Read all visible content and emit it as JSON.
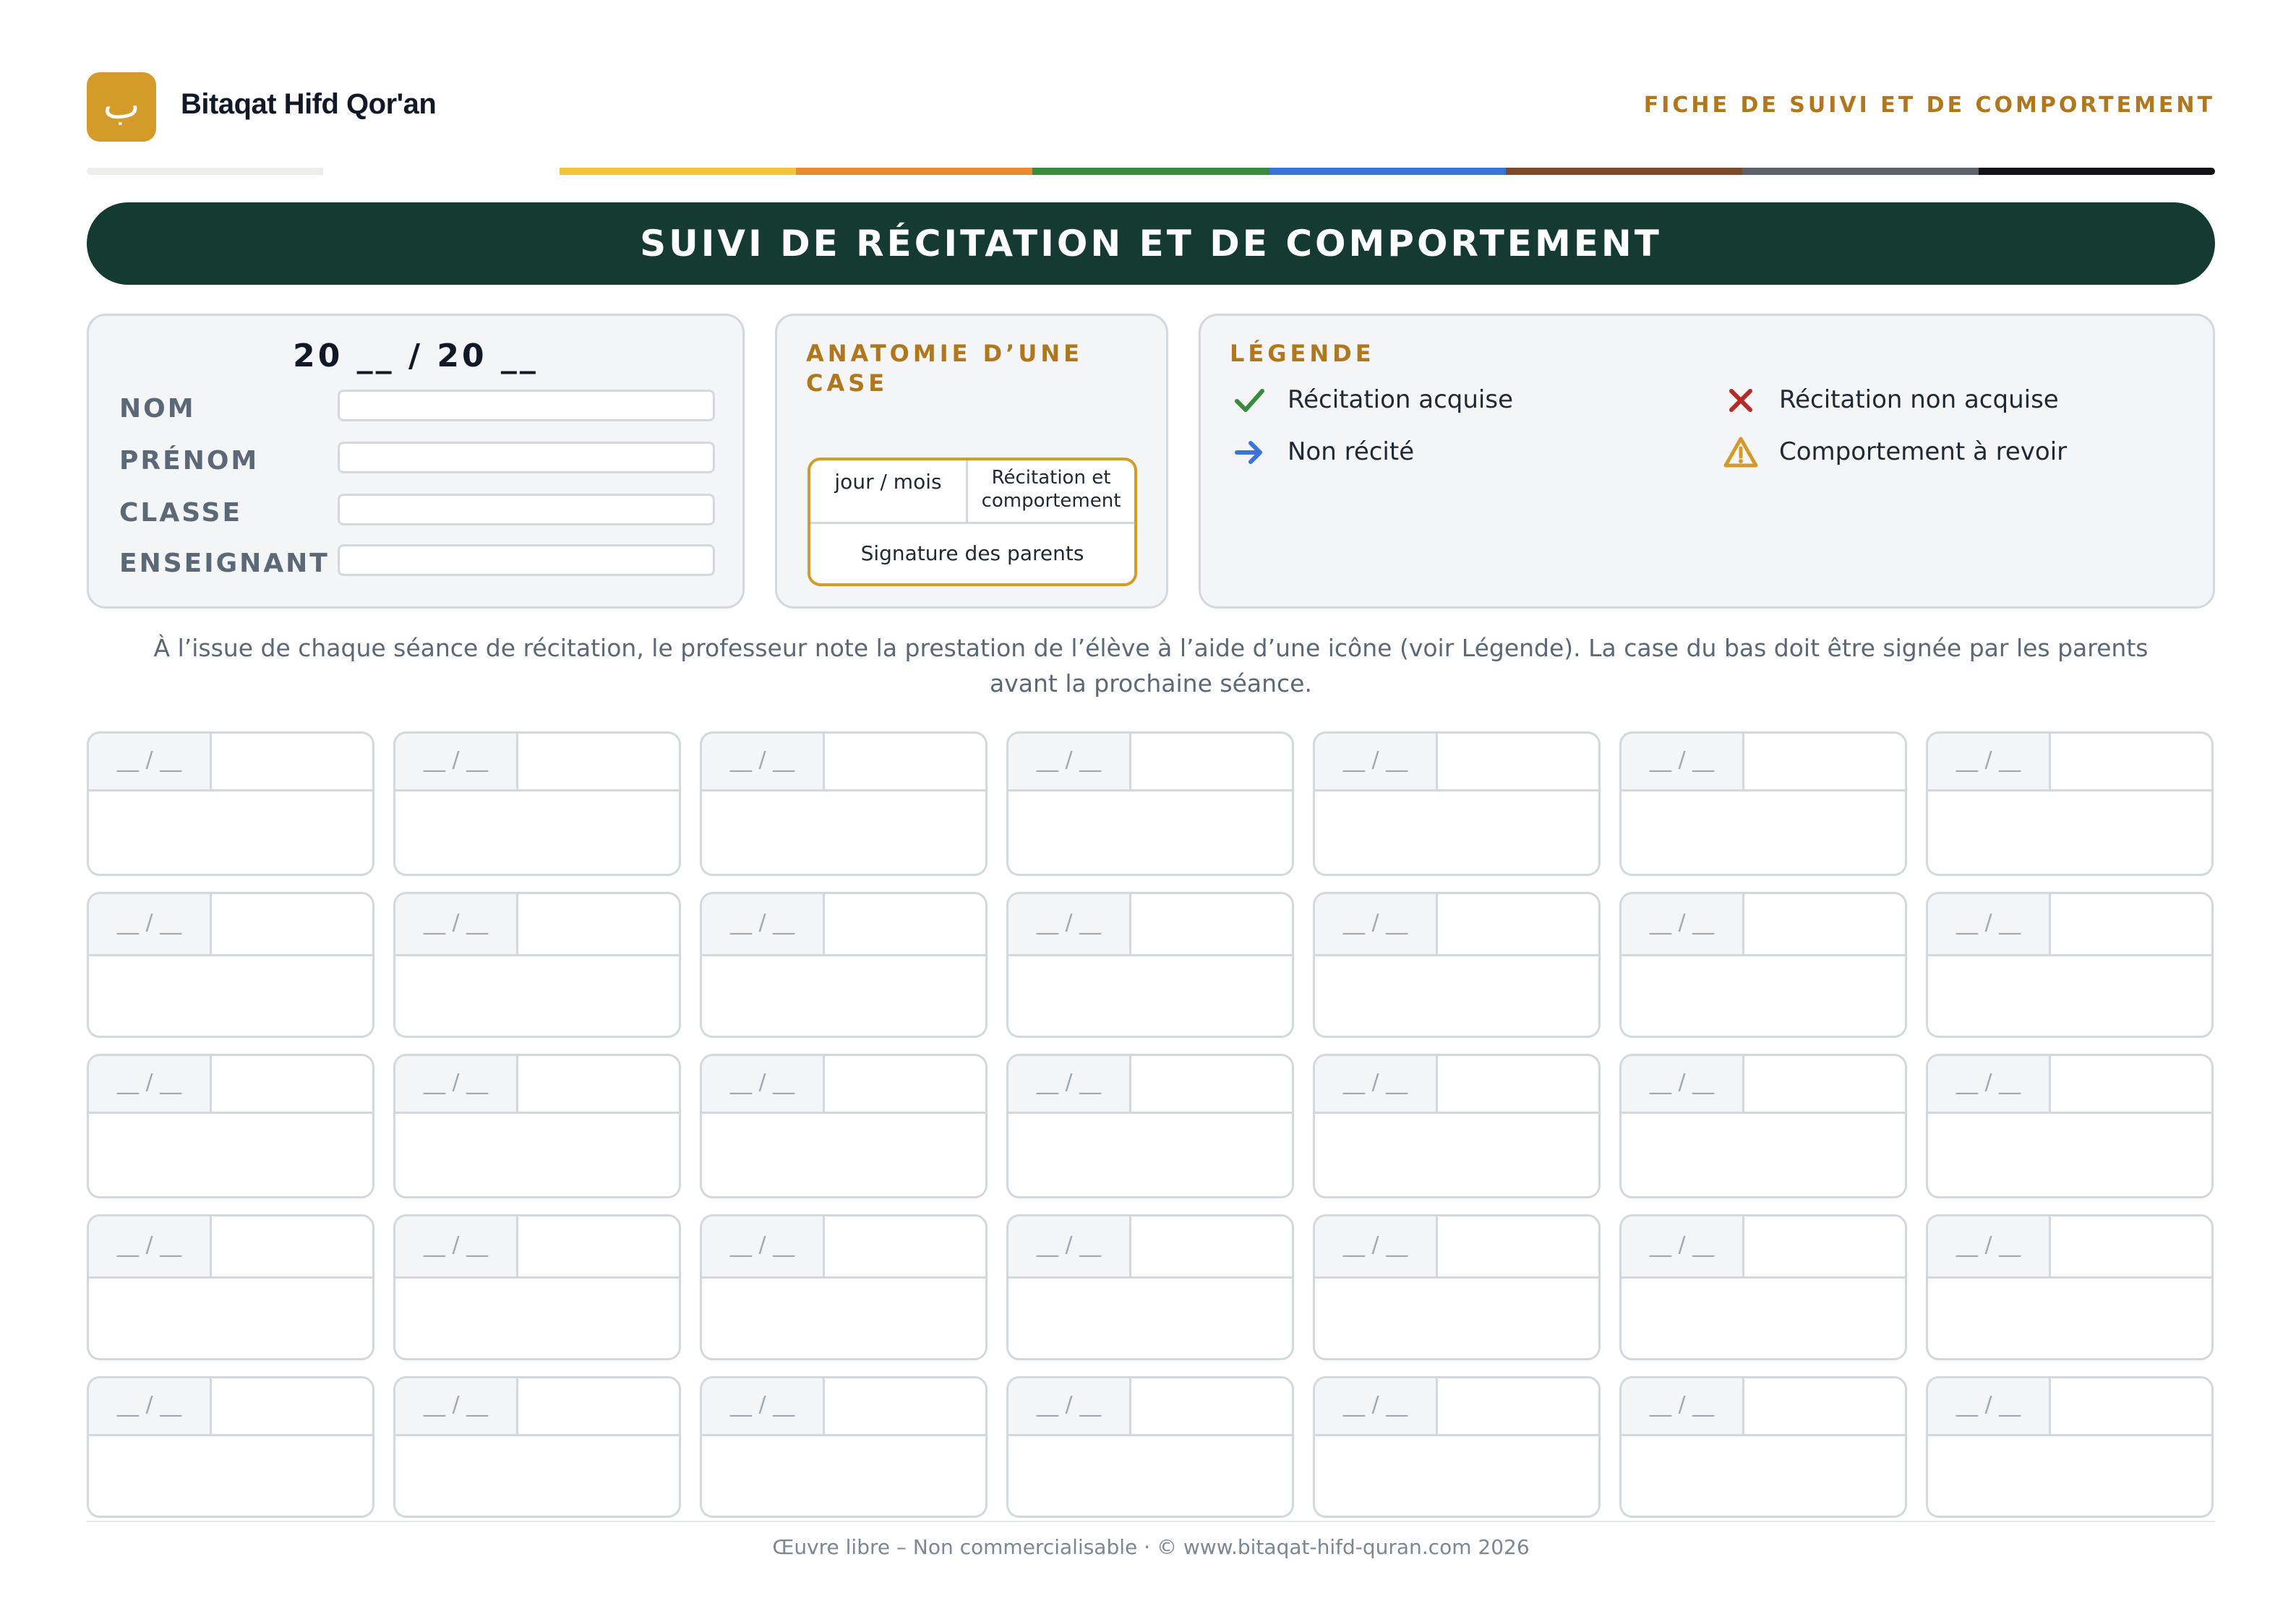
{
  "header": {
    "logo_glyph": "ب",
    "brand": "Bitaqat Hifd Qor'an",
    "doc_type": "FICHE DE SUIVI ET DE COMPORTEMENT"
  },
  "strip_colors": [
    "#efedea",
    "#ffffff",
    "#f2c43a",
    "#e98a2e",
    "#3a8a3e",
    "#3b74d8",
    "#7a4a2a",
    "#5b6069",
    "#111318"
  ],
  "title": "SUIVI DE RÉCITATION ET DE COMPORTEMENT",
  "info": {
    "year": "20 __ / 20 __",
    "fields": [
      {
        "label": "NOM",
        "value": ""
      },
      {
        "label": "PRÉNOM",
        "value": ""
      },
      {
        "label": "CLASSE",
        "value": ""
      },
      {
        "label": "ENSEIGNANT",
        "value": ""
      }
    ]
  },
  "anatomy": {
    "title": "ANATOMIE D’UNE CASE",
    "date_label": "jour / mois",
    "mark_label": "Récitation et comportement",
    "signature_label": "Signature des parents"
  },
  "legend": {
    "title": "LÉGENDE",
    "items": [
      {
        "icon": "check-icon",
        "label": "Récitation acquise",
        "color": "#3a8a3e"
      },
      {
        "icon": "cross-icon",
        "label": "Récitation non acquise",
        "color": "#b52a25"
      },
      {
        "icon": "arrow-right-icon",
        "label": "Non récité",
        "color": "#3b74d8"
      },
      {
        "icon": "warning-icon",
        "label": "Comportement à revoir",
        "color": "#d49a2a"
      }
    ]
  },
  "instruction": "À l’issue de chaque séance de récitation, le professeur note la prestation de l’élève à l’aide d’une icône (voir Légende). La case du bas doit être signée par les parents avant la prochaine séance.",
  "grid": {
    "rows": 5,
    "cols": 7,
    "date_placeholder": "__ / __"
  },
  "footer": "Œuvre libre – Non commercialisable · © www.bitaqat-hifd-quran.com 2026"
}
